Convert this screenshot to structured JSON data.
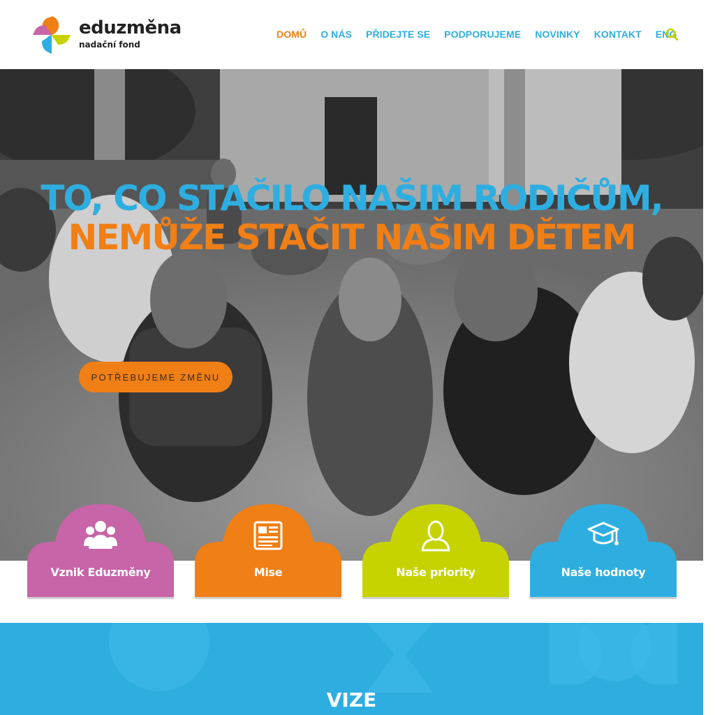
{
  "brand": {
    "name": "eduzměna",
    "subtitle": "nadační fond",
    "colors": {
      "blue": "#2eaee0",
      "orange": "#f07f16",
      "pink": "#c864a8",
      "lime": "#c6d300"
    }
  },
  "nav": {
    "items": [
      {
        "label": "DOMŮ",
        "active": true
      },
      {
        "label": "O NÁS"
      },
      {
        "label": "PŘIDEJTE SE"
      },
      {
        "label": "PODPORUJEME"
      },
      {
        "label": "NOVINKY"
      },
      {
        "label": "KONTAKT"
      },
      {
        "label": "ENG"
      }
    ],
    "search_icon": "search-icon"
  },
  "hero": {
    "line1": "TO, CO STAČILO NAŠIM RODIČŮM,",
    "line2": "NEMŮŽE STAČIT NAŠIM DĚTEM",
    "cta_label": "POTŘEBUJEME ZMĚNU"
  },
  "cards": [
    {
      "label": "Vznik Eduzměny",
      "icon": "people-icon",
      "color": "#c864a8"
    },
    {
      "label": "Mise",
      "icon": "document-icon",
      "color": "#f07f16"
    },
    {
      "label": "Naše priority",
      "icon": "person-icon",
      "color": "#c6d300"
    },
    {
      "label": "Naše hodnoty",
      "icon": "graduation-cap-icon",
      "color": "#2eaee0"
    }
  ],
  "vize": {
    "title": "VIZE"
  }
}
